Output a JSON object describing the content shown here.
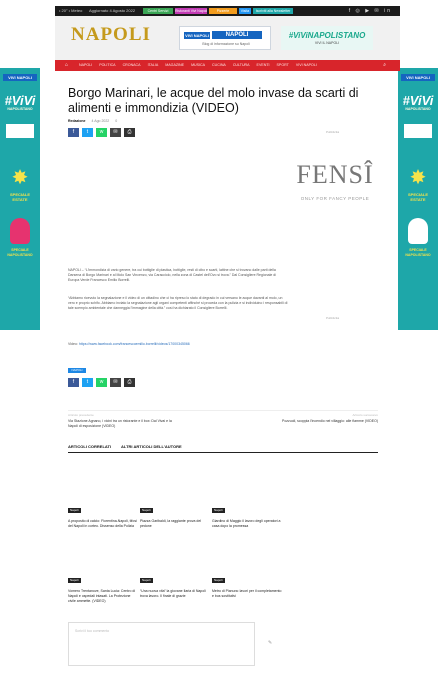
{
  "topbar": {
    "date": "• 20° • Meteo",
    "updated": "Aggiornato 4 Agosto 2022",
    "chips": [
      {
        "label": "Centri Servizi",
        "color": "#3aa655"
      },
      {
        "label": "Ristoranti Vivi Napoli",
        "color": "#c23bb4"
      },
      {
        "label": "Pizzerie",
        "color": "#f29c1e"
      },
      {
        "label": "Visita",
        "color": "#2196f3"
      },
      {
        "label": "Iscriviti alla Newsletter",
        "color": "#1ea7a9"
      }
    ],
    "social": "f ◎ ▶ ✉ in"
  },
  "header": {
    "logo": "NAPOLI",
    "ad_napoli": {
      "brand": "VIVI NAPOLI",
      "title": "NAPOLI",
      "subtitle": "Blog di informazione su Napoli"
    },
    "ad_vivi": {
      "title": "#ViViNAPOLISTANO",
      "subtitle": "VIVI IL NAPOLI"
    }
  },
  "nav": {
    "home_icon": "⌂",
    "items": [
      "NAPOLI",
      "POLITICA",
      "CRONACA",
      "ITALIA",
      "MAGAZINE",
      "MUSICA",
      "CUCINA",
      "CULTURA",
      "EVENTI",
      "SPORT",
      "VIVI NAPOLI"
    ],
    "search_icon": "⌕"
  },
  "skins": {
    "badge": "VIVI NAPOLI",
    "vivi": "#ViVi",
    "sub": "NAPOLISTANO",
    "star_label": "SPECIALE ESTATE",
    "flower_label": "SPECIALE NAPOLISTANO"
  },
  "article": {
    "title": "Borgo Marinari, le acque del molo invase da scarti di alimenti e immondizia (VIDEO)",
    "author": "Redazione",
    "date": "4 Ago 2022",
    "comments": "0",
    "share_colors": [
      "#3b5998",
      "#1da1f2",
      "#25d366",
      "#444444",
      "#333333"
    ],
    "share_icons": [
      "f",
      "t",
      "w",
      "✉",
      "⎙"
    ],
    "paragraphs": [
      "NAPOLI – “L'immondizia di vario genere, tra cui bottiglie di plastica, bottiglie, resti di cibo e scarti, lattine che si trovano dalle parti della Darsena di Borgo Marinari e al Molo San Vincenzo, via Caracciolo, nella zona di Castel dell'Ovo si trova.” Dal Consigliere Regionale di Europa Verde Francesco Emilio Borrelli.",
      "“Abbiamo ricevuto la segnalazione e il video di un cittadino che ci ha ripreso lo stato di degrado in cui versano le acque davanti al molo, un vero e proprio schifo. Abbiamo inviato la segnalazione agli organi competenti affinché si proceda con la pulizia e si individuino i responsabili di tale scempio ambientale che danneggia l'immagine della città.” così ha dichiarato il Consigliere Borrelli.",
      ""
    ],
    "video_prefix": "Video:",
    "video_url": "https://www.facebook.com/francescoemilio.borrelli/videos/17000345066",
    "tag": "NAPOLI",
    "right_labels": [
      "Pubblicità",
      "Pubblicità"
    ],
    "fensi_logo": "FENSÎ",
    "fensi_tag": "ONLY FOR FANCY PEOPLE"
  },
  "prev_next": {
    "prev_label": "Articolo precedente",
    "prev_title": "Via Stazione Agnano, i vicini tra un ristorante e il box: Dai Vivai e la Napoli di esposizione (VIDEO)",
    "next_label": "Articolo successivo",
    "next_title": "Pozzuoli, scoppia l'incendio nel villaggio: alle fiamme (VIDEO)"
  },
  "related": {
    "tab1": "ARTICOLI CORRELATI",
    "tab2": "ALTRI ARTICOLI DELL'AUTORE",
    "cards": [
      {
        "badge": "Napoli",
        "title": "A proposito di calcio: Fiorentina-Napoli, tifosi del Napoli in corteo. Dissenso della Polizia"
      },
      {
        "badge": "Napoli",
        "title": "Piazza Garibaldi, la raggiante prova del pedone"
      },
      {
        "badge": "Napoli",
        "title": "Giardino di Maggio il lavoro degli operatori a casa dopo la promessa"
      },
      {
        "badge": "Napoli",
        "title": "Vomero Trentanove, Santa Lucia: Centro di Napoli e ospedali intasati. La Protezione civile ammette. (VIDEO)"
      },
      {
        "badge": "Napoli",
        "title": "“Una nuova vita” la giovane Ilaria di Napoli trova lavoro. Il finale di grazie"
      },
      {
        "badge": "Napoli",
        "title": "Metro di Pianura: lavori per il completamento e bus sostitutivi"
      }
    ]
  },
  "comments": {
    "placeholder": "Scrivi il tuo commento"
  }
}
